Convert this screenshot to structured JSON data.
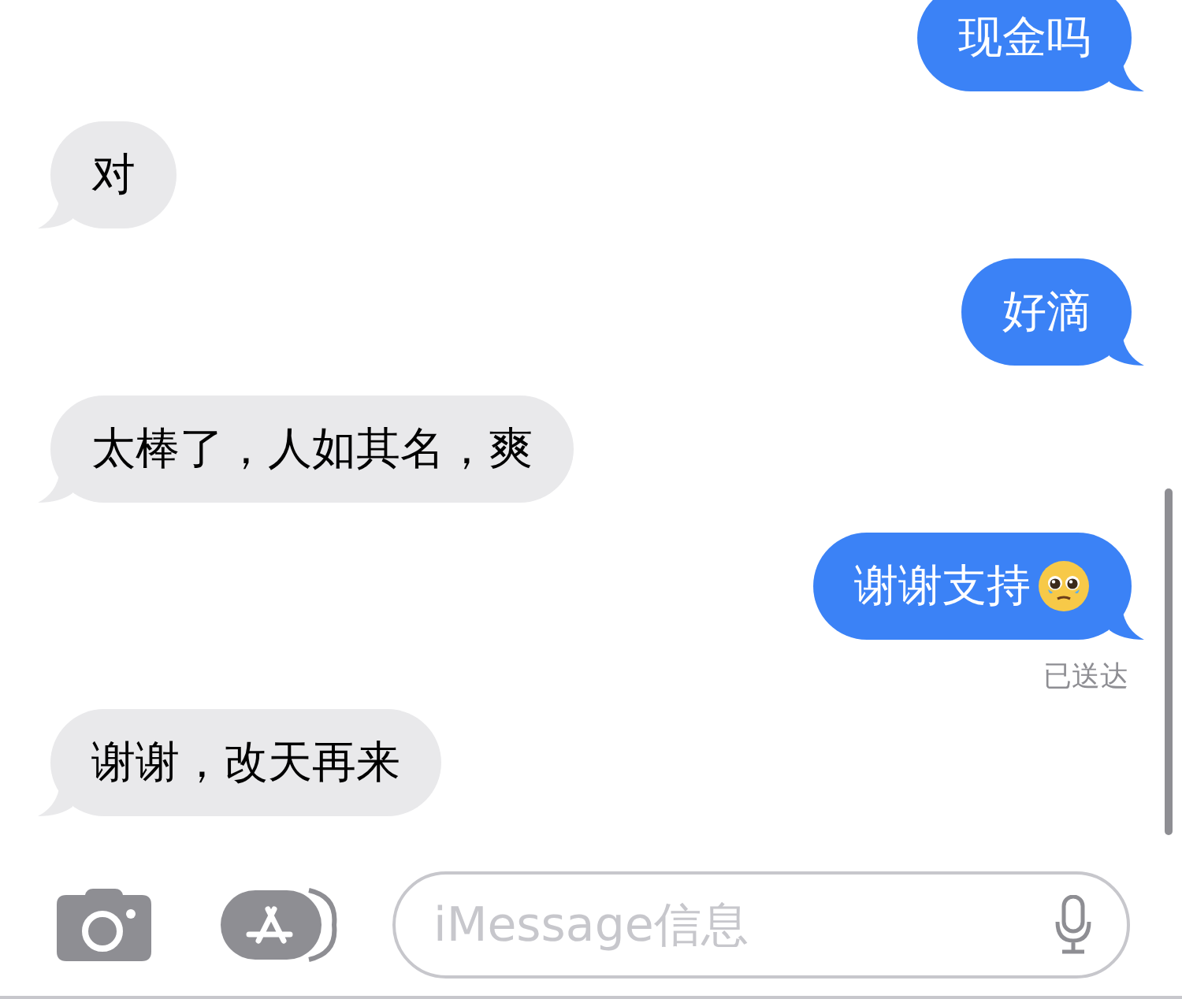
{
  "messages": [
    {
      "kind": "sent",
      "text": "现金吗"
    },
    {
      "kind": "received",
      "text": "对"
    },
    {
      "kind": "sent",
      "text": "好滴"
    },
    {
      "kind": "received",
      "text": "太棒了，人如其名，爽"
    },
    {
      "kind": "sent",
      "text": "谢谢支持",
      "emoji": true,
      "status": "已送达"
    },
    {
      "kind": "received",
      "text": "谢谢，改天再来"
    }
  ],
  "composer": {
    "placeholder": "iMessage信息"
  }
}
